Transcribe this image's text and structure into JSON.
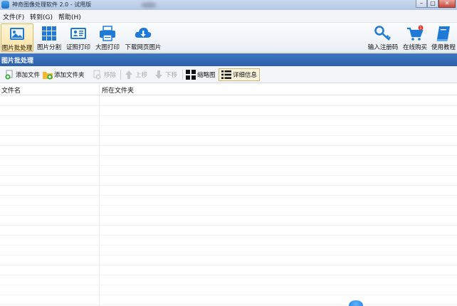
{
  "window": {
    "title": "神奇图像处理软件 2.0 - 试用版",
    "controls": [
      "–",
      "□",
      "✕"
    ]
  },
  "menu": [
    {
      "label": "文件(F)"
    },
    {
      "label": "转到(G)"
    },
    {
      "label": "帮助(H)"
    }
  ],
  "toolbar": {
    "left": [
      {
        "label": "图片批处理",
        "icon": "image-icon",
        "active": true
      },
      {
        "label": "图片分割",
        "icon": "grid-icon"
      },
      {
        "label": "证照打印",
        "icon": "id-card-icon"
      },
      {
        "label": "大图打印",
        "icon": "printer-icon"
      },
      {
        "label": "下载网页图片",
        "icon": "cloud-download-icon"
      }
    ],
    "right": [
      {
        "label": "输入注册码",
        "icon": "key-icon"
      },
      {
        "label": "在线购买",
        "icon": "cart-icon",
        "badge": "1"
      },
      {
        "label": "使用教程",
        "icon": "book-icon"
      }
    ]
  },
  "panel": {
    "title": "图片批处理"
  },
  "actions": [
    {
      "label": "添加文件",
      "icon": "add-file-icon",
      "enabled": true
    },
    {
      "label": "添加文件夹",
      "icon": "add-folder-icon",
      "enabled": true
    },
    {
      "label": "移除",
      "icon": "remove-icon",
      "enabled": false
    },
    {
      "label": "上移",
      "icon": "arrow-up-icon",
      "enabled": false
    },
    {
      "label": "下移",
      "icon": "arrow-down-icon",
      "enabled": false
    },
    {
      "label": "缩略图",
      "icon": "thumbnail-icon",
      "enabled": true
    },
    {
      "label": "详细信息",
      "icon": "details-list-icon",
      "enabled": true,
      "selected": true
    }
  ],
  "table": {
    "columns": [
      "文件名",
      "所在文件夹"
    ],
    "rows": []
  },
  "colors": {
    "accent": "#2c5fa8",
    "toolbar_icon": "#1e7ad6",
    "badge": "#e03a2e"
  }
}
